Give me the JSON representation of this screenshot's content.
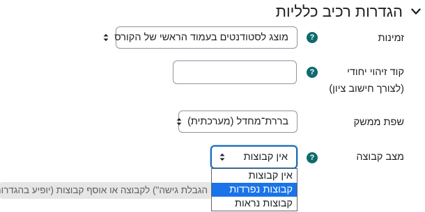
{
  "section": {
    "title": "הגדרות רכיב כלליות",
    "collapse_icon": "chevron-down-icon"
  },
  "fields": {
    "availability": {
      "label": "זמינות",
      "value": "מוצג לסטודנטים בעמוד הראשי של הקורס"
    },
    "idnumber": {
      "label_line1": "קוד זיהוי יחודי",
      "label_line2": "(לצורך חישוב ציון)",
      "value": ""
    },
    "language": {
      "label": "שפת ממשק",
      "value": "בררת־מחדל (מערכתית)"
    },
    "groupmode": {
      "label": "מצב קבוצה",
      "value": "אין קבוצות",
      "options": [
        "אין קבוצות",
        "קבוצות נפרדות",
        "קבוצות נראות"
      ],
      "highlighted_index": 1
    },
    "grouping_hint": {
      "text": "הגבלת גישה\") לקבוצה או אוסף קבוצות (יופיע בהגדרות \""
    }
  },
  "help_icon_glyph": "?",
  "colors": {
    "help_icon_bg": "#0f6a6d",
    "focus_border": "#1a6cb6",
    "option_highlight": "#1a73e8"
  }
}
